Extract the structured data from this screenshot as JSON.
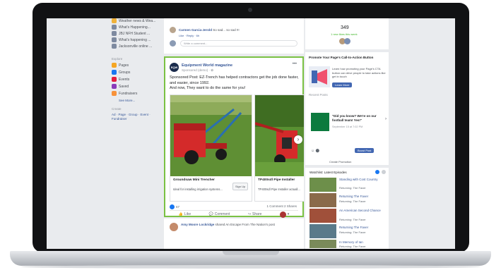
{
  "sidebar": {
    "items": [
      {
        "label": "Weather news & Wea...",
        "color": "#f0b23a"
      },
      {
        "label": "What's Happening...",
        "color": "#7e8aa0"
      },
      {
        "label": "JBJ NFH Student ...",
        "color": "#7e8aa0"
      },
      {
        "label": "What's happening ...",
        "color": "#7e8aa0"
      },
      {
        "label": "Jacksonville online ...",
        "color": "#7e8aa0"
      }
    ],
    "explore_heading": "Explore",
    "explore_items": [
      {
        "label": "Pages",
        "color": "#f5a623"
      },
      {
        "label": "Groups",
        "color": "#1877f2"
      },
      {
        "label": "Events",
        "color": "#e41e3f"
      },
      {
        "label": "Saved",
        "color": "#8a3ab9"
      },
      {
        "label": "Fundraisers",
        "color": "#f7923a"
      }
    ],
    "see_more": "See More...",
    "create_heading": "Create",
    "create_links": "Ad · Page · Group · Event · Fundraiser"
  },
  "feed": {
    "top_comment": {
      "name": "Carmen Garcia-Jerold",
      "text": "So sad... so sad !!!",
      "meta": "Like · Reply · 6h"
    },
    "comment_placeholder": "Write a comment...",
    "post": {
      "logo_text": "EQW",
      "page_name": "Equipment World magazine",
      "sponsored": "Sponsored (demo) · ✿",
      "body": "Sponsored Post: EZ-Trench has helped contractors get the job done faster, and easier, since 1992.",
      "body2": "And now, They want to do the same for you!",
      "cards": [
        {
          "title": "Groundsaw Mini Trencher",
          "desc": "Ideal for installing irrigation systems...",
          "button": "Sign Up"
        },
        {
          "title": "TP400sdl Pipe Installer",
          "desc": "TP400sdl Pipe Installer actuall..."
        }
      ],
      "reaction_count": "67",
      "comments_shares": "1 Comment  2 Shares",
      "actions": [
        "Like",
        "Comment",
        "Share"
      ]
    },
    "next_post": {
      "name": "Amy Moore Lockridge",
      "text": "shared An Escape From The Nation's post"
    }
  },
  "right": {
    "stat_number": "349",
    "stat_label": "1 new likes this week",
    "promote_title": "Promote Your Page's Call-to-Action Button",
    "promote_text": "Learn how promoting your Page's CTA button can drive people to take actions like get in touch",
    "learn_more": "Learn More",
    "recent_posts": "Recent Posts",
    "recent_post_text": "\"Did you know? We're on our football team! Yes!\"",
    "recent_post_meta": "September 15 at 7:02 PM",
    "boost_label": "Boost Post",
    "create_promotion": "Create Promotion",
    "watchlist_heading": "Watchlist: Latest Episodes",
    "episodes": [
      {
        "title": "Standing with Cost Country",
        "sub": "Returning: The Faver",
        "color": "#6d8f4a"
      },
      {
        "title": "Returning The Faver",
        "sub": "Returning: The Faver",
        "color": "#8a6a4a"
      },
      {
        "title": "An American Second Chance",
        "sub": "Returning: The Faver",
        "color": "#a0503a"
      },
      {
        "title": "Returning The Faver",
        "sub": "Returning: The Faver",
        "color": "#5a7a8a"
      },
      {
        "title": "In Memory of Ian",
        "sub": "Returning: The Faver",
        "color": "#7a8a5a"
      }
    ],
    "see_all": "See All"
  }
}
